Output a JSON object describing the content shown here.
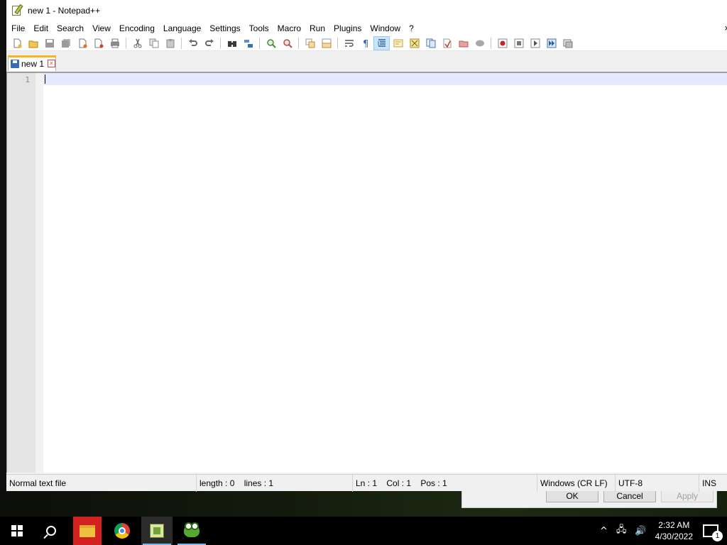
{
  "window": {
    "title": "new 1 - Notepad++",
    "accent": "#fab41e"
  },
  "menubar": {
    "items": [
      "File",
      "Edit",
      "Search",
      "View",
      "Encoding",
      "Language",
      "Settings",
      "Tools",
      "Macro",
      "Run",
      "Plugins",
      "Window",
      "?"
    ],
    "close_glyph": "×"
  },
  "toolbar": {
    "icons": [
      "new-file-icon",
      "open-file-icon",
      "save-icon",
      "save-all-icon",
      "close-icon",
      "close-all-icon",
      "print-icon",
      "cut-icon",
      "copy-icon",
      "paste-icon",
      "undo-icon",
      "redo-icon",
      "find-icon",
      "replace-icon",
      "zoom-in-icon",
      "zoom-out-icon",
      "sync-vertical-icon",
      "sync-horizontal-icon",
      "word-wrap-icon",
      "show-all-chars-icon",
      "indent-guide-icon",
      "user-language-icon",
      "document-map-icon",
      "function-list-icon",
      "folder-as-workspace-icon",
      "monitoring-icon",
      "record-macro-icon",
      "stop-record-icon",
      "play-macro-icon",
      "run-macro-multiple-icon",
      "save-macro-icon"
    ]
  },
  "tabs": [
    {
      "label": "new 1",
      "close_glyph": "×"
    }
  ],
  "editor": {
    "line_numbers": [
      "1"
    ],
    "current_line_color": "#e8e8ff"
  },
  "statusbar": {
    "file_type": "Normal text file",
    "length_lines": "length : 0    lines : 1",
    "position": "Ln : 1    Col : 1    Pos : 1",
    "eol": "Windows (CR LF)",
    "encoding": "UTF-8",
    "mode": "INS"
  },
  "dialog_behind": {
    "ok": "OK",
    "cancel": "Cancel",
    "apply": "Apply"
  },
  "taskbar": {
    "time": "2:32 AM",
    "date": "4/30/2022",
    "notification_count": "1",
    "tray_chevron": "^",
    "network_glyph": "🖧",
    "volume_glyph": "🔊"
  }
}
